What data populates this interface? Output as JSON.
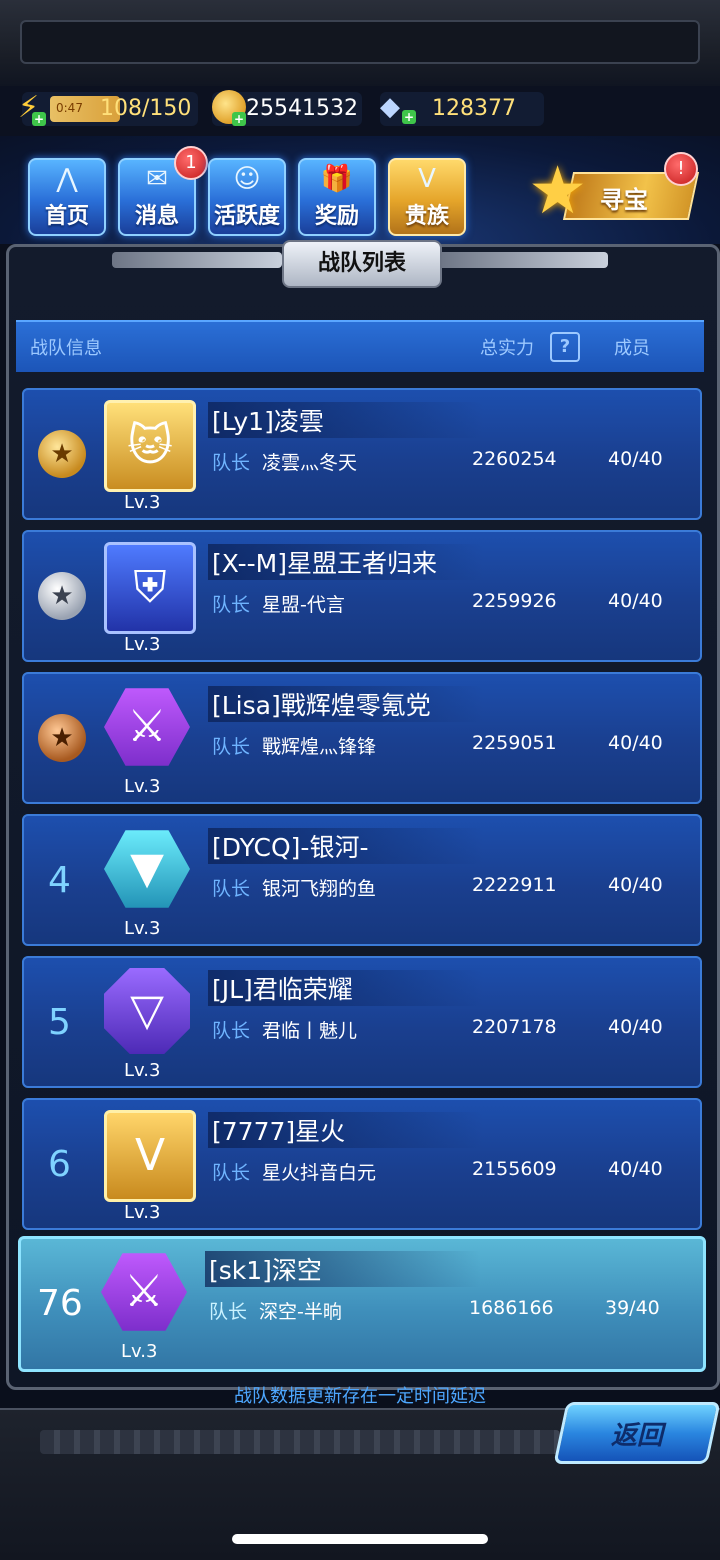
{
  "resources": {
    "energy_timer": "0:47",
    "energy": "108/150",
    "gold": "25541532",
    "diamonds": "128377"
  },
  "nav": {
    "home": "首页",
    "messages": "消息",
    "messages_badge": "1",
    "activity": "活跃度",
    "rewards": "奖励",
    "noble": "贵族",
    "treasure": "寻宝",
    "treasure_badge": "!"
  },
  "panel": {
    "title": "战队列表",
    "col_info": "战队信息",
    "col_power": "总实力",
    "col_help": "?",
    "col_members": "成员",
    "captain_label": "队长",
    "footer_note": "战队数据更新存在一定时间延迟",
    "back": "返回"
  },
  "teams": [
    {
      "rank": "1",
      "name": "[Ly1]凌雲",
      "captain": "凌雲灬冬天",
      "power": "2260254",
      "members": "40/40",
      "level": "Lv.3"
    },
    {
      "rank": "2",
      "name": "[X--M]星盟王者归来",
      "captain": "星盟-代言",
      "power": "2259926",
      "members": "40/40",
      "level": "Lv.3"
    },
    {
      "rank": "3",
      "name": "[Lisa]戰辉煌零氪党",
      "captain": "戰辉煌灬锋锋",
      "power": "2259051",
      "members": "40/40",
      "level": "Lv.3"
    },
    {
      "rank": "4",
      "name": "[DYCQ]-银河-",
      "captain": "银河飞翔的鱼",
      "power": "2222911",
      "members": "40/40",
      "level": "Lv.3"
    },
    {
      "rank": "5",
      "name": "[JL]君临荣耀",
      "captain": "君临丨魅儿",
      "power": "2207178",
      "members": "40/40",
      "level": "Lv.3"
    },
    {
      "rank": "6",
      "name": "[7777]星火",
      "captain": "星火抖音白元",
      "power": "2155609",
      "members": "40/40",
      "level": "Lv.3"
    }
  ],
  "my_team": {
    "rank": "76",
    "name": "[sk1]深空",
    "captain": "深空-半晌",
    "power": "1686166",
    "members": "39/40",
    "level": "Lv.3"
  }
}
